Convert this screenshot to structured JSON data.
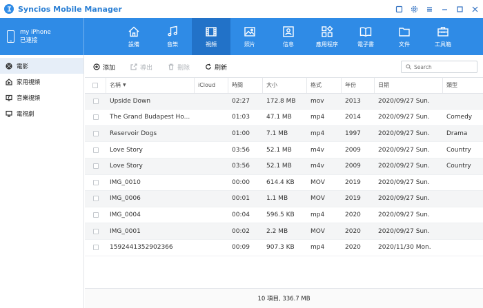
{
  "app": {
    "title": "Syncios Mobile Manager"
  },
  "device": {
    "name": "my iPhone",
    "status": "已連接"
  },
  "nav": {
    "tabs": [
      {
        "label": "設備",
        "icon": "home-icon"
      },
      {
        "label": "音樂",
        "icon": "music-icon"
      },
      {
        "label": "視頻",
        "icon": "video-icon",
        "active": true
      },
      {
        "label": "照片",
        "icon": "photo-icon"
      },
      {
        "label": "信息",
        "icon": "contact-card-icon"
      },
      {
        "label": "應用程序",
        "icon": "apps-icon"
      },
      {
        "label": "電子書",
        "icon": "book-icon"
      },
      {
        "label": "文件",
        "icon": "folder-icon"
      },
      {
        "label": "工具箱",
        "icon": "toolbox-icon"
      }
    ]
  },
  "sidebar": {
    "items": [
      {
        "label": "電影",
        "icon": "film-reel-icon"
      },
      {
        "label": "家用視頻",
        "icon": "home-video-icon"
      },
      {
        "label": "音樂視頻",
        "icon": "music-video-icon"
      },
      {
        "label": "電視劇",
        "icon": "tv-icon"
      }
    ]
  },
  "toolbar": {
    "add": "添加",
    "export": "導出",
    "delete": "刪除",
    "refresh": "刷新",
    "search_placeholder": "Search"
  },
  "table": {
    "columns": {
      "name": "名稱",
      "icloud": "iCloud",
      "time": "時間",
      "size": "大小",
      "format": "格式",
      "year": "年份",
      "date": "日期",
      "genre": "類型"
    },
    "rows": [
      {
        "name": "Upside Down",
        "icloud": "",
        "time": "02:27",
        "size": "172.8 MB",
        "format": "mov",
        "year": "2013",
        "date": "2020/09/27 Sun.",
        "genre": ""
      },
      {
        "name": "The Grand Budapest Ho...",
        "icloud": "",
        "time": "01:03",
        "size": "47.1 MB",
        "format": "mp4",
        "year": "2014",
        "date": "2020/09/27 Sun.",
        "genre": "Comedy"
      },
      {
        "name": "Reservoir Dogs",
        "icloud": "",
        "time": "01:00",
        "size": "7.1 MB",
        "format": "mp4",
        "year": "1997",
        "date": "2020/09/27 Sun.",
        "genre": "Drama"
      },
      {
        "name": "Love Story",
        "icloud": "",
        "time": "03:56",
        "size": "52.1 MB",
        "format": "m4v",
        "year": "2009",
        "date": "2020/09/27 Sun.",
        "genre": "Country"
      },
      {
        "name": "Love Story",
        "icloud": "",
        "time": "03:56",
        "size": "52.1 MB",
        "format": "m4v",
        "year": "2009",
        "date": "2020/09/27 Sun.",
        "genre": "Country"
      },
      {
        "name": "IMG_0010",
        "icloud": "",
        "time": "00:00",
        "size": "614.4 KB",
        "format": "MOV",
        "year": "2019",
        "date": "2020/09/27 Sun.",
        "genre": ""
      },
      {
        "name": "IMG_0006",
        "icloud": "",
        "time": "00:01",
        "size": "1.1 MB",
        "format": "MOV",
        "year": "2019",
        "date": "2020/09/27 Sun.",
        "genre": ""
      },
      {
        "name": "IMG_0004",
        "icloud": "",
        "time": "00:04",
        "size": "596.5 KB",
        "format": "mp4",
        "year": "2020",
        "date": "2020/09/27 Sun.",
        "genre": ""
      },
      {
        "name": "IMG_0001",
        "icloud": "",
        "time": "00:02",
        "size": "2.2 MB",
        "format": "MOV",
        "year": "2020",
        "date": "2020/09/27 Sun.",
        "genre": ""
      },
      {
        "name": "1592441352902366",
        "icloud": "",
        "time": "00:09",
        "size": "907.3 KB",
        "format": "mp4",
        "year": "2020",
        "date": "2020/11/30 Mon.",
        "genre": ""
      }
    ]
  },
  "footer": {
    "summary": "10 項目, 336.7 MB"
  },
  "colors": {
    "accent": "#2f8be6",
    "active_tab": "#2272c8",
    "title": "#2a7fd4"
  }
}
